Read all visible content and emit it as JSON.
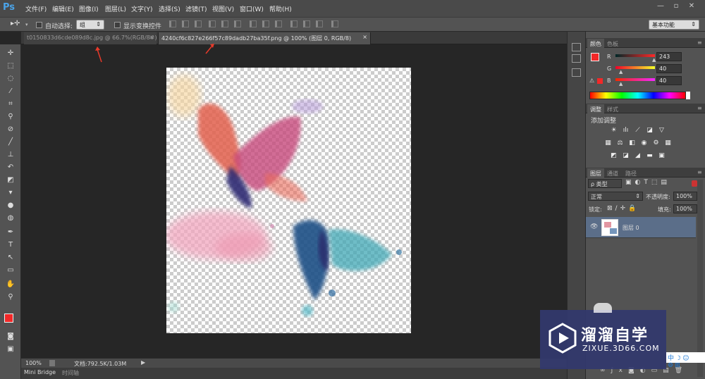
{
  "app": {
    "logo": "Ps"
  },
  "menu": [
    "文件(F)",
    "编辑(E)",
    "图像(I)",
    "图层(L)",
    "文字(Y)",
    "选择(S)",
    "滤镜(T)",
    "视图(V)",
    "窗口(W)",
    "帮助(H)"
  ],
  "window_controls": [
    "—",
    "▫",
    "✕"
  ],
  "options_bar": {
    "auto_select_label": "自动选择:",
    "auto_select_value": "组",
    "show_transform_label": "显示变换控件",
    "workspace": "基本功能"
  },
  "tabs": [
    {
      "label": "t0150833d6cde089d8c.jpg @ 66.7%(RGB/8#)",
      "close": "×"
    },
    {
      "label": "4240cf6c827e266f57c89dadb27ba35f.png @ 100% (图层 0, RGB/8)",
      "close": "×"
    }
  ],
  "status": {
    "zoom": "100%",
    "doc_info": "文档:792.5K/1.03M"
  },
  "bottom_tabs": [
    "Mini Bridge",
    "时间轴"
  ],
  "color_panel": {
    "tabs": [
      "颜色",
      "色板"
    ],
    "channels": [
      {
        "label": "R",
        "value": "243"
      },
      {
        "label": "G",
        "value": "40"
      },
      {
        "label": "B",
        "value": "40"
      }
    ],
    "foreground": "#f32828"
  },
  "adjust_panel": {
    "tabs": [
      "调整",
      "样式"
    ],
    "title": "添加调整"
  },
  "layers_panel": {
    "tabs": [
      "图层",
      "通道",
      "路径"
    ],
    "filter": "ρ 类型",
    "blend_mode": "正常",
    "opacity_label": "不透明度:",
    "opacity": "100%",
    "lock_label": "锁定:",
    "fill_label": "填充:",
    "fill": "100%",
    "layers": [
      {
        "name": "图层 0"
      }
    ]
  },
  "watermark": {
    "brand": "溜溜自学",
    "url": "ZIXUE.3D66.COM"
  }
}
